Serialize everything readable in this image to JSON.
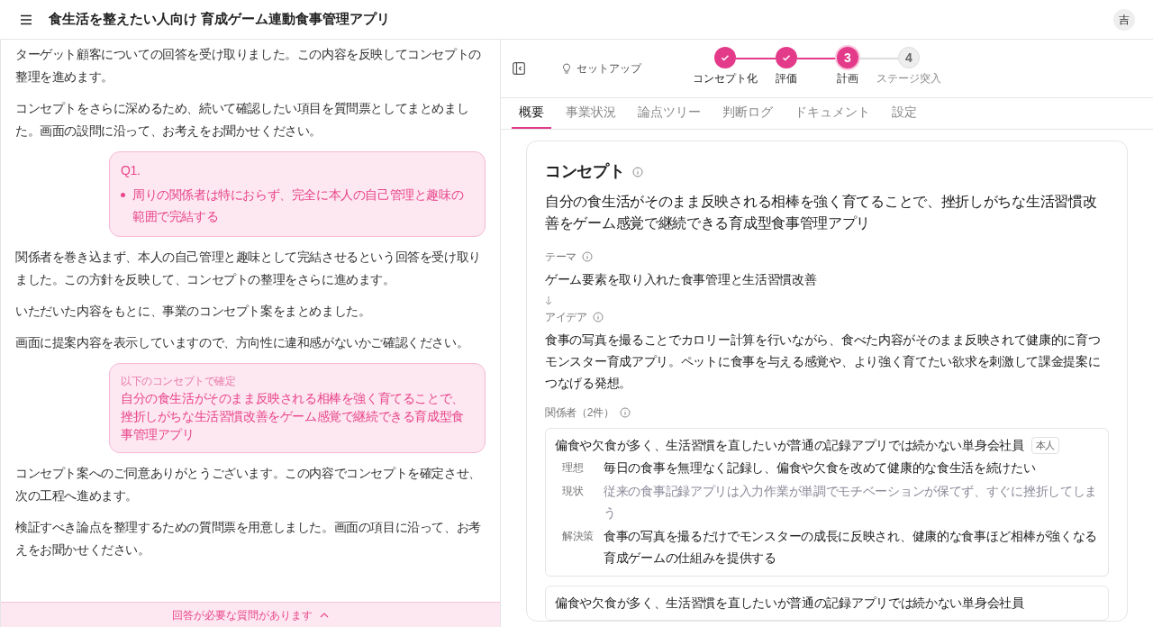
{
  "header": {
    "title": "食生活を整えたい人向け 育成ゲーム連動食事管理アプリ",
    "avatar": "吉"
  },
  "chat": {
    "messages": [
      {
        "kind": "text",
        "text": "ターゲット顧客についての回答を受け取りました。この内容を反映してコンセプトの整理を進めます。"
      },
      {
        "kind": "text",
        "text": "コンセプトをさらに深めるため、続いて確認したい項目を質問票としてまとめました。画面の設問に沿って、お考えをお聞かせください。"
      },
      {
        "kind": "question",
        "label": "Q1.",
        "items": [
          "周りの関係者は特におらず、完全に本人の自己管理と趣味の範囲で完結する"
        ]
      },
      {
        "kind": "text",
        "text": "関係者を巻き込まず、本人の自己管理と趣味として完結させるという回答を受け取りました。この方針を反映して、コンセプトの整理をさらに進めます。"
      },
      {
        "kind": "text",
        "text": "いただいた内容をもとに、事業のコンセプト案をまとめました。"
      },
      {
        "kind": "text",
        "text": "画面に提案内容を表示していますので、方向性に違和感がないかご確認ください。"
      },
      {
        "kind": "confirm",
        "caption": "以下のコンセプトで確定",
        "text": "自分の食生活がそのまま反映される相棒を強く育てることで、挫折しがちな生活習慣改善をゲーム感覚で継続できる育成型食事管理アプリ"
      },
      {
        "kind": "text",
        "text": "コンセプト案へのご同意ありがとうございます。この内容でコンセプトを確定させ、次の工程へ進めます。"
      },
      {
        "kind": "text",
        "text": "検証すべき論点を整理するための質問票を用意しました。画面の項目に沿って、お考えをお聞かせください。"
      }
    ],
    "notice": "回答が必要な質問があります"
  },
  "toolbar": {
    "setup": "セットアップ",
    "steps": [
      {
        "label": "コンセプト化",
        "completed": true,
        "selected": false
      },
      {
        "label": "評価",
        "completed": true,
        "selected": false
      },
      {
        "label": "計画",
        "number": "3",
        "completed": false,
        "selected": true
      },
      {
        "label": "ステージ突入",
        "number": "4",
        "completed": false,
        "selected": false
      }
    ]
  },
  "tabs": [
    {
      "label": "概要",
      "selected": true
    },
    {
      "label": "事業状況",
      "selected": false
    },
    {
      "label": "論点ツリー",
      "selected": false
    },
    {
      "label": "判断ログ",
      "selected": false
    },
    {
      "label": "ドキュメント",
      "selected": false
    },
    {
      "label": "設定",
      "selected": false
    }
  ],
  "concept": {
    "title": "コンセプト",
    "statement": "自分の食生活がそのまま反映される相棒を強く育てることで、挫折しがちな生活習慣改善をゲーム感覚で継続できる育成型食事管理アプリ",
    "theme": {
      "label": "テーマ",
      "value": "ゲーム要素を取り入れた食事管理と生活習慣改善"
    },
    "idea": {
      "label": "アイデア",
      "value": "食事の写真を撮ることでカロリー計算を行いながら、食べた内容がそのまま反映されて健康的に育つモンスター育成アプリ。ペットに食事を与える感覚や、より強く育てたい欲求を刺激して課金提案につなげる発想。"
    },
    "stakeholders": {
      "label": "関係者（2件）",
      "items": [
        {
          "name": "偏食や欠食が多く、生活習慣を直したいが普通の記録アプリでは続かない単身会社員",
          "tag": "本人",
          "rows": [
            {
              "label": "理想",
              "value": "毎日の食事を無理なく記録し、偏食や欠食を改めて健康的な食生活を続けたい",
              "kind": "normal"
            },
            {
              "label": "現状",
              "value": "従来の食事記録アプリは入力作業が単調でモチベーションが保てず、すぐに挫折してしまう",
              "kind": "muted"
            },
            {
              "label": "解決策",
              "value": "食事の写真を撮るだけでモンスターの成長に反映され、健康的な食事ほど相棒が強くなる育成ゲームの仕組みを提供する",
              "kind": "normal"
            }
          ]
        },
        {
          "name": "偏食や欠食が多く、生活習慣を直したいが普通の記録アプリでは続かない単身会社員"
        }
      ]
    }
  }
}
